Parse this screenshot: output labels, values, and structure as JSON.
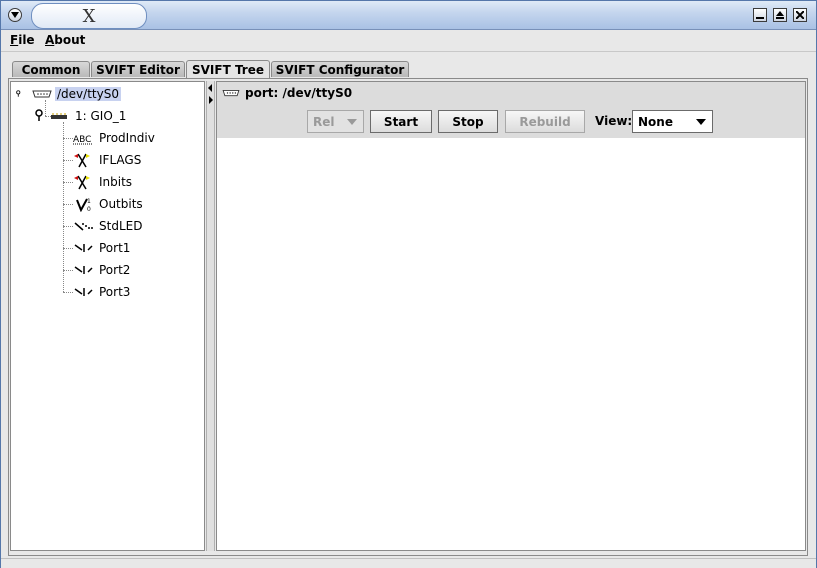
{
  "window": {
    "title_glyph": "X"
  },
  "menubar": {
    "file": {
      "accel": "F",
      "rest": "ile"
    },
    "about": {
      "accel": "A",
      "rest": "bout"
    }
  },
  "tabs": [
    {
      "label": "Common",
      "active": false
    },
    {
      "label": "SVIFT Editor",
      "active": false
    },
    {
      "label": "SVIFT Tree",
      "active": true
    },
    {
      "label": "SVIFT Configurator",
      "active": false
    }
  ],
  "tree": {
    "root": {
      "label": "/dev/ttyS0",
      "icon": "serial-port-icon",
      "selected": true
    },
    "device": {
      "label": "1: GIO_1",
      "icon": "device-icon"
    },
    "children": [
      {
        "label": "ProdIndiv",
        "icon": "abc-text-icon"
      },
      {
        "label": "IFLAGS",
        "icon": "flags-icon"
      },
      {
        "label": "Inbits",
        "icon": "flags-icon"
      },
      {
        "label": "Outbits",
        "icon": "outbits-icon"
      },
      {
        "label": "StdLED",
        "icon": "led-icon"
      },
      {
        "label": "Port1",
        "icon": "switch-icon"
      },
      {
        "label": "Port2",
        "icon": "switch-icon"
      },
      {
        "label": "Port3",
        "icon": "switch-icon"
      }
    ]
  },
  "detail": {
    "port_label": "port: /dev/ttyS0",
    "mode_select": {
      "value": "Rel",
      "enabled": false
    },
    "start_label": "Start",
    "stop_label": "Stop",
    "rebuild_label": "Rebuild",
    "view_label": "View:",
    "view_select": {
      "value": "None"
    }
  },
  "colors": {
    "selection": "#c8d2f0",
    "titlebar": "#a9c1e4"
  }
}
